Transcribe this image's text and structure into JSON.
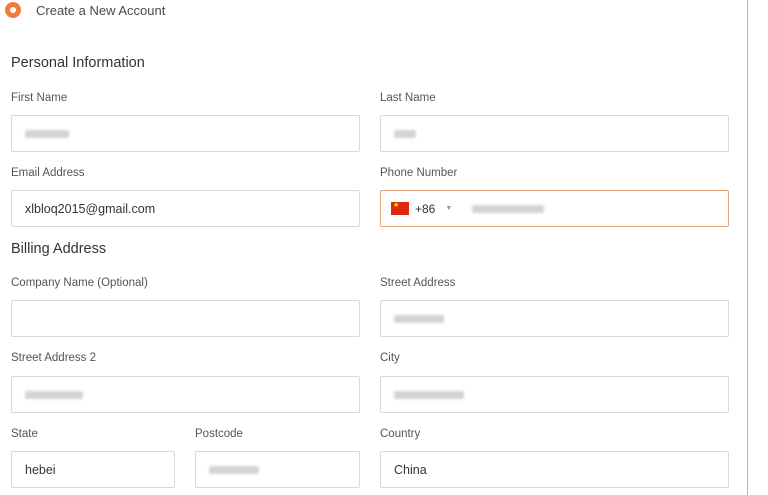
{
  "account_option": {
    "label": "Create a New Account"
  },
  "personal": {
    "title": "Personal Information",
    "first_name": {
      "label": "First Name",
      "value": ""
    },
    "last_name": {
      "label": "Last Name",
      "value": ""
    },
    "email": {
      "label": "Email Address",
      "value": "xlbloq2015@gmail.com"
    },
    "phone": {
      "label": "Phone Number",
      "country_code": "+86",
      "value": ""
    }
  },
  "billing": {
    "title": "Billing Address",
    "company": {
      "label": "Company Name (Optional)",
      "value": ""
    },
    "street": {
      "label": "Street Address",
      "value": ""
    },
    "street2": {
      "label": "Street Address 2",
      "value": ""
    },
    "city": {
      "label": "City",
      "value": ""
    },
    "state": {
      "label": "State",
      "value": "hebei"
    },
    "postcode": {
      "label": "Postcode",
      "value": ""
    },
    "country": {
      "label": "Country",
      "value": "China"
    }
  },
  "colors": {
    "accent": "#f07b3f",
    "active_border": "#e2a47c",
    "field_border": "#d9d9d9"
  },
  "icons": {
    "flag": "china-flag-icon",
    "dropdown": "caret-down-icon"
  }
}
